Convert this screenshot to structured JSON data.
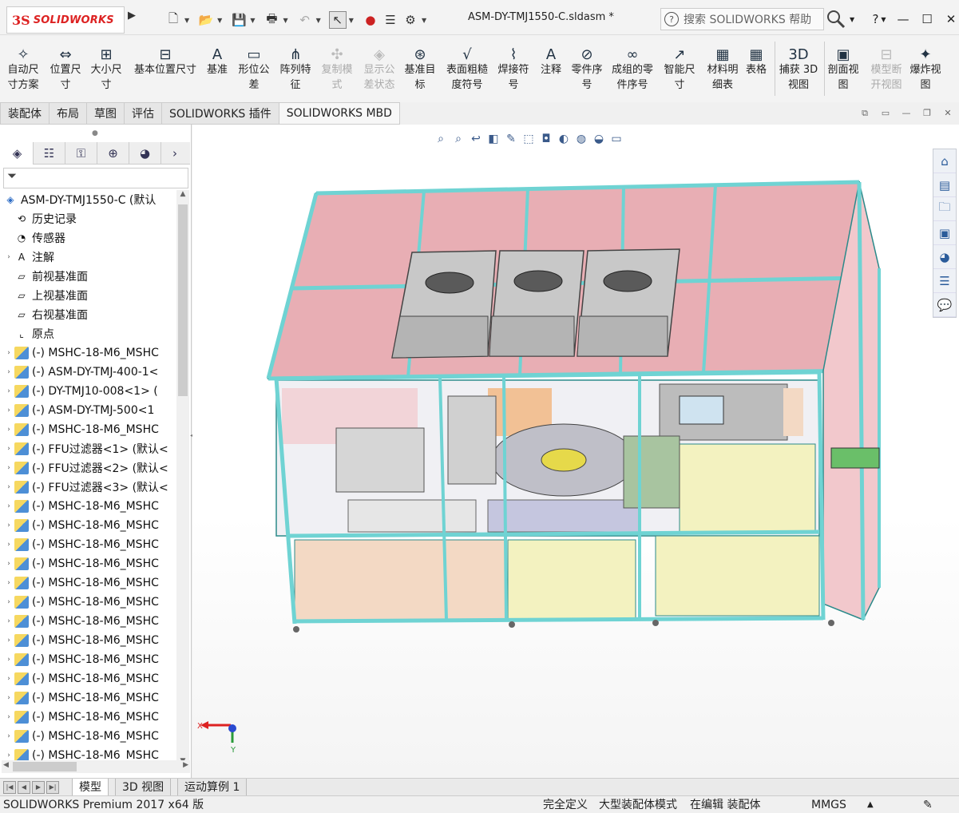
{
  "window": {
    "logo_prefix": "3S",
    "logo_text": "SOLIDWORKS",
    "doc_title": "ASM-DY-TMJ1550-C.sldasm *",
    "search_placeholder": "搜索 SOLIDWORKS 帮助",
    "help_label": "?"
  },
  "ribbon": {
    "items": [
      {
        "label": "自动尺\n寸方案",
        "icon": "auto-dimension-icon"
      },
      {
        "label": "位置尺\n寸",
        "icon": "location-dimension-icon"
      },
      {
        "label": "大小尺\n寸",
        "icon": "size-dimension-icon"
      },
      {
        "label": "基本位置尺寸",
        "icon": "basic-location-dimension-icon"
      },
      {
        "label": "基准",
        "icon": "datum-icon"
      },
      {
        "label": "形位公\n差",
        "icon": "geometric-tolerance-icon"
      },
      {
        "label": "阵列特\n征",
        "icon": "pattern-feature-icon"
      },
      {
        "label": "复制模\n式",
        "icon": "copy-scheme-icon"
      },
      {
        "label": "显示公\n差状态",
        "icon": "show-tolerance-status-icon"
      },
      {
        "label": "基准目\n标",
        "icon": "datum-target-icon"
      },
      {
        "label": "表面粗糙\n度符号",
        "icon": "surface-finish-icon"
      },
      {
        "label": "焊接符\n号",
        "icon": "weld-symbol-icon"
      },
      {
        "label": "注释",
        "icon": "note-icon"
      },
      {
        "label": "零件序\n号",
        "icon": "balloon-icon"
      },
      {
        "label": "成组的零\n件序号",
        "icon": "stacked-balloon-icon"
      },
      {
        "label": "智能尺\n寸",
        "icon": "smart-dimension-icon"
      },
      {
        "label": "材料明\n细表",
        "icon": "bom-icon"
      },
      {
        "label": "表格",
        "icon": "table-icon"
      },
      {
        "label": "捕获 3D\n视图",
        "icon": "capture-3d-view-icon"
      },
      {
        "label": "剖面视\n图",
        "icon": "section-view-icon"
      },
      {
        "label": "模型断\n开视图",
        "icon": "model-break-view-icon"
      },
      {
        "label": "爆炸视\n图",
        "icon": "exploded-view-icon"
      }
    ]
  },
  "tabs": [
    "装配体",
    "布局",
    "草图",
    "评估",
    "SOLIDWORKS 插件",
    "SOLIDWORKS MBD"
  ],
  "tree": {
    "root": "ASM-DY-TMJ1550-C  (默认",
    "items": [
      {
        "label": "历史记录",
        "icon": "history-icon",
        "exp": ""
      },
      {
        "label": "传感器",
        "icon": "sensor-icon",
        "exp": ""
      },
      {
        "label": "注解",
        "icon": "annotation-icon",
        "exp": "›"
      },
      {
        "label": "前视基准面",
        "icon": "plane-icon",
        "exp": ""
      },
      {
        "label": "上视基准面",
        "icon": "plane-icon",
        "exp": ""
      },
      {
        "label": "右视基准面",
        "icon": "plane-icon",
        "exp": ""
      },
      {
        "label": "原点",
        "icon": "origin-icon",
        "exp": ""
      },
      {
        "label": "(-) MSHC-18-M6_MSHC",
        "icon": "part-icon",
        "exp": "›"
      },
      {
        "label": "(-) ASM-DY-TMJ-400-1<",
        "icon": "part-icon",
        "exp": "›"
      },
      {
        "label": "(-) DY-TMJ10-008<1> (",
        "icon": "part-icon",
        "exp": "›"
      },
      {
        "label": "(-) ASM-DY-TMJ-500<1",
        "icon": "part-icon",
        "exp": "›"
      },
      {
        "label": "(-) MSHC-18-M6_MSHC",
        "icon": "part-icon",
        "exp": "›"
      },
      {
        "label": "(-) FFU过滤器<1> (默认<",
        "icon": "part-icon",
        "exp": "›"
      },
      {
        "label": "(-) FFU过滤器<2> (默认<",
        "icon": "part-icon",
        "exp": "›"
      },
      {
        "label": "(-) FFU过滤器<3> (默认<",
        "icon": "part-icon",
        "exp": "›"
      },
      {
        "label": "(-) MSHC-18-M6_MSHC",
        "icon": "part-icon",
        "exp": "›"
      },
      {
        "label": "(-) MSHC-18-M6_MSHC",
        "icon": "part-icon",
        "exp": "›"
      },
      {
        "label": "(-) MSHC-18-M6_MSHC",
        "icon": "part-icon",
        "exp": "›"
      },
      {
        "label": "(-) MSHC-18-M6_MSHC",
        "icon": "part-icon",
        "exp": "›"
      },
      {
        "label": "(-) MSHC-18-M6_MSHC",
        "icon": "part-icon",
        "exp": "›"
      },
      {
        "label": "(-) MSHC-18-M6_MSHC",
        "icon": "part-icon",
        "exp": "›"
      },
      {
        "label": "(-) MSHC-18-M6_MSHC",
        "icon": "part-icon",
        "exp": "›"
      },
      {
        "label": "(-) MSHC-18-M6_MSHC",
        "icon": "part-icon",
        "exp": "›"
      },
      {
        "label": "(-) MSHC-18-M6_MSHC",
        "icon": "part-icon",
        "exp": "›"
      },
      {
        "label": "(-) MSHC-18-M6_MSHC",
        "icon": "part-icon",
        "exp": "›"
      },
      {
        "label": "(-) MSHC-18-M6_MSHC",
        "icon": "part-icon",
        "exp": "›"
      },
      {
        "label": "(-) MSHC-18-M6_MSHC",
        "icon": "part-icon",
        "exp": "›"
      },
      {
        "label": "(-) MSHC-18-M6_MSHC",
        "icon": "part-icon",
        "exp": "›"
      },
      {
        "label": "(-) MSHC-18-M6_MSHC",
        "icon": "part-icon",
        "exp": "›"
      }
    ]
  },
  "triad": {
    "x": "X",
    "y": "Y"
  },
  "bottom_tabs": [
    "模型",
    "3D 视图",
    "运动算例 1"
  ],
  "status": {
    "product": "SOLIDWORKS Premium 2017 x64 版",
    "defined": "完全定义",
    "mode": "大型装配体模式",
    "editing": "在编辑 装配体",
    "units": "MMGS"
  },
  "colors": {
    "panel_pink": "#e8aeb4",
    "frame_teal": "#6fd3d3",
    "panel_yellow": "#f3f2c0",
    "hood_gray": "#c8c8c8"
  }
}
